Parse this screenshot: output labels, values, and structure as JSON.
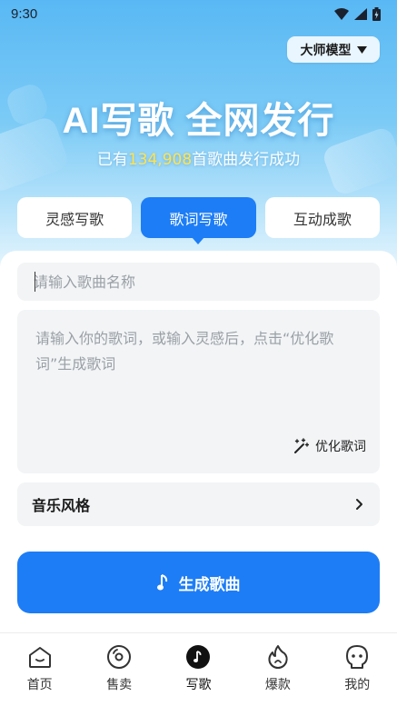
{
  "status_bar": {
    "time": "9:30"
  },
  "header": {
    "model_label": "大师模型",
    "title": "AI写歌 全网发行",
    "subtitle_prefix": "已有",
    "subtitle_count": "134,908",
    "subtitle_suffix": "首歌曲发行成功"
  },
  "tabs": [
    {
      "label": "灵感写歌",
      "active": false
    },
    {
      "label": "歌词写歌",
      "active": true
    },
    {
      "label": "互动成歌",
      "active": false
    }
  ],
  "form": {
    "song_name_placeholder": "请输入歌曲名称",
    "lyrics_placeholder": "请输入你的歌词，或输入灵感后，点击“优化歌词”生成歌词",
    "optimize_label": "优化歌词",
    "style_label": "音乐风格",
    "generate_label": "生成歌曲"
  },
  "colors": {
    "accent": "#1d7df6",
    "highlight": "#ffe34d"
  },
  "bottom_nav": [
    {
      "label": "首页",
      "icon": "home-icon"
    },
    {
      "label": "售卖",
      "icon": "disc-icon"
    },
    {
      "label": "写歌",
      "icon": "music-note-icon",
      "active": true
    },
    {
      "label": "爆款",
      "icon": "flame-icon"
    },
    {
      "label": "我的",
      "icon": "profile-icon"
    }
  ]
}
